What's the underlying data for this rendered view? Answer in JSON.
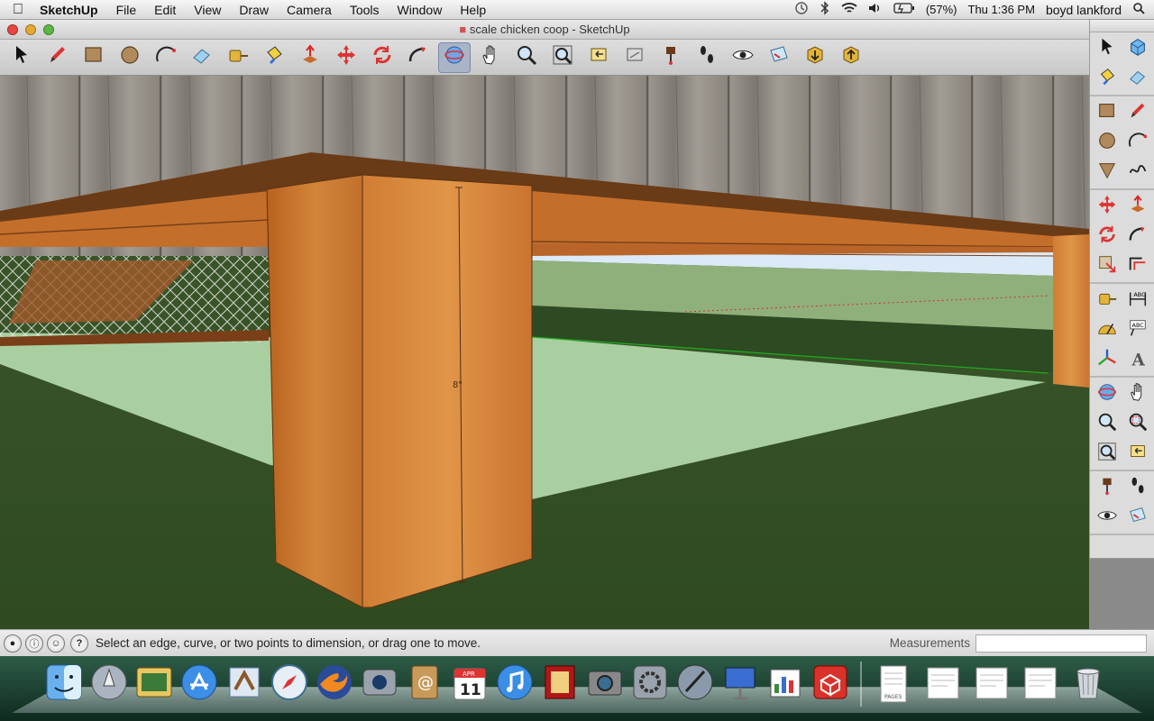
{
  "menubar": {
    "app_name": "SketchUp",
    "menus": [
      "File",
      "Edit",
      "View",
      "Draw",
      "Camera",
      "Tools",
      "Window",
      "Help"
    ],
    "battery": "(57%)",
    "clock": "Thu 1:36 PM",
    "user": "boyd lankford"
  },
  "window": {
    "title": "scale chicken coop - SketchUp"
  },
  "toolbar": {
    "tools": [
      "select-icon",
      "pencil-icon",
      "rectangle-icon",
      "circle-icon",
      "arc-icon",
      "eraser-icon",
      "tape-measure-icon",
      "paint-bucket-icon",
      "push-pull-icon",
      "move-icon",
      "rotate-icon",
      "follow-me-icon",
      "orbit-icon",
      "pan-icon",
      "zoom-icon",
      "zoom-extents-icon",
      "previous-view-icon",
      "next-view-icon",
      "position-camera-icon",
      "walk-icon",
      "look-around-icon",
      "section-plane-icon",
      "get-models-icon",
      "share-model-icon"
    ],
    "active_tool": "orbit-icon"
  },
  "palette": {
    "groups": [
      [
        "select-icon",
        "component-icon",
        "paint-bucket-icon",
        "eraser-icon"
      ],
      [
        "rectangle-icon",
        "pencil-icon",
        "circle-icon",
        "arc-icon",
        "polygon-icon",
        "freehand-icon"
      ],
      [
        "move-icon",
        "push-pull-icon",
        "rotate-icon",
        "follow-me-icon",
        "scale-icon",
        "offset-icon"
      ],
      [
        "tape-measure-icon",
        "dimension-icon",
        "protractor-icon",
        "text-icon",
        "axes-icon",
        "3d-text-icon"
      ],
      [
        "orbit-icon",
        "pan-icon",
        "zoom-icon",
        "zoom-window-icon",
        "zoom-extents-icon",
        "previous-view-icon"
      ],
      [
        "position-camera-icon",
        "walk-icon",
        "look-around-icon",
        "section-plane-icon"
      ]
    ]
  },
  "viewport": {
    "dimension_label": "8\""
  },
  "statusbar": {
    "message": "Select an edge, curve, or two points to dimension, or drag one to move.",
    "measurements_label": "Measurements",
    "measurements_value": ""
  },
  "dock": {
    "apps": [
      "finder-icon",
      "launchpad-icon",
      "photo-browser-icon",
      "app-store-icon",
      "mail-icon",
      "safari-icon",
      "firefox-icon",
      "facetime-icon",
      "address-book-icon",
      "calendar-icon",
      "itunes-icon",
      "photo-booth-icon",
      "iphoto-icon",
      "system-preferences-icon",
      "script-editor-icon",
      "keynote-icon",
      "numbers-icon",
      "sketchup-icon"
    ],
    "calendar_month": "APR",
    "calendar_day": "11",
    "files": [
      "pages-document-icon",
      "document-icon",
      "document-icon",
      "document-icon",
      "trash-icon"
    ],
    "pages_label": "PAGES"
  },
  "colors": {
    "wood": "#c8742a",
    "grass": "#3f5a2a",
    "ground_plane": "#a9cfa0",
    "sky": "#dbeaf6",
    "fence": "#8e8a83",
    "green_axis": "#22aa22",
    "red_axis": "#cc3333"
  }
}
